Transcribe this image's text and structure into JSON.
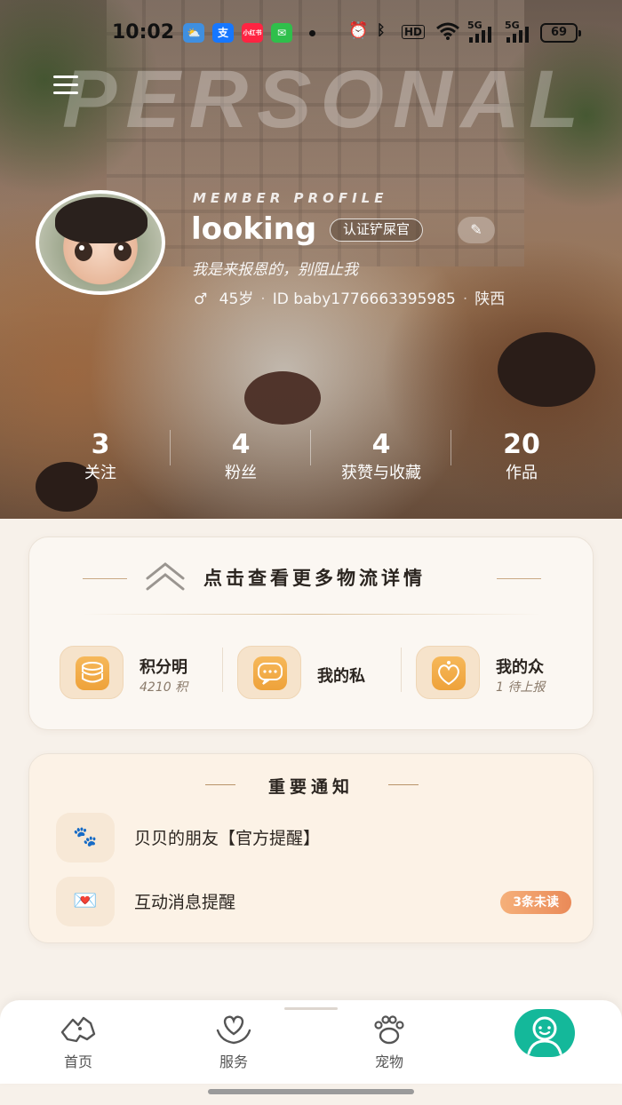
{
  "status_bar": {
    "time": "10:02",
    "apps": [
      {
        "name": "weather-app-icon",
        "glyph": "⛅",
        "color": "#3f8fe0"
      },
      {
        "name": "alipay-app-icon",
        "glyph": "支",
        "color": "#1677ff"
      },
      {
        "name": "xiaohongshu-app-icon",
        "glyph": "小红书",
        "color": "#ff2442"
      },
      {
        "name": "messages-app-icon",
        "glyph": "✉",
        "color": "#2fbf4b"
      }
    ],
    "hd": "HD",
    "network_1": "5G",
    "network_2": "5G",
    "battery": "69"
  },
  "header": {
    "watermark": "PERSONAL",
    "member_label": "MEMBER PROFILE",
    "username": "looking",
    "cert_badge": "认证铲屎官",
    "bio": "我是来报恩的，别阻止我",
    "gender_icon": "♂",
    "age": "45岁",
    "id_text": "ID baby1776663395985",
    "location": "陕西",
    "separator": "·"
  },
  "stats": [
    {
      "num": "3",
      "label": "关注"
    },
    {
      "num": "4",
      "label": "粉丝"
    },
    {
      "num": "4",
      "label": "获赞与收藏"
    },
    {
      "num": "20",
      "label": "作品"
    }
  ],
  "logistics": {
    "title": "点击查看更多物流详情",
    "quick_actions": [
      {
        "title": "积分明",
        "sub": "4210 积",
        "icon": "coin-stack-icon"
      },
      {
        "title": "我的私",
        "sub": "",
        "icon": "chat-bubble-icon"
      },
      {
        "title": "我的众",
        "sub": "1 待上报",
        "icon": "paw-heart-icon"
      }
    ]
  },
  "notice": {
    "title": "重要通知",
    "items": [
      {
        "icon": "🐾",
        "text": "贝贝的朋友【官方提醒】",
        "badge": ""
      },
      {
        "icon": "💌",
        "text": "互动消息提醒",
        "badge": "3条未读"
      }
    ]
  },
  "tabbar": {
    "tabs": [
      {
        "label": "首页",
        "icon": "home-dog-icon"
      },
      {
        "label": "服务",
        "icon": "service-heart-icon"
      },
      {
        "label": "宠物",
        "icon": "paw-icon"
      },
      {
        "label": "",
        "icon": "profile-face-icon"
      }
    ],
    "accent": "#14b89a"
  },
  "colors": {
    "page_bg": "#f7f1ea",
    "gold_accent": "#c9a985",
    "badge_orange": "#ea8a58"
  }
}
